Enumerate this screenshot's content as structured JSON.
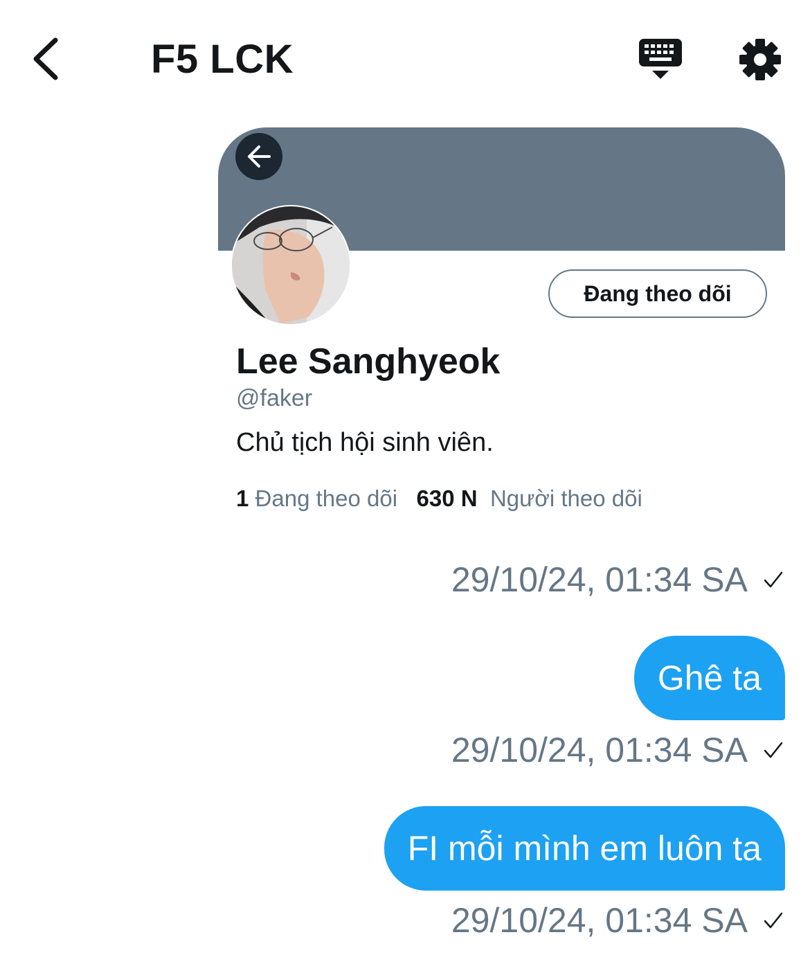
{
  "header": {
    "title": "F5 LCK",
    "back_icon": "chevron-left-icon",
    "keyboard_icon": "keyboard-icon",
    "settings_icon": "gear-icon"
  },
  "profile_card": {
    "banner_color": "#657786",
    "banner_back_icon": "arrow-left-icon",
    "follow_button_label": "Đang theo dõi",
    "name": "Lee Sanghyeok",
    "handle": "@faker",
    "bio": "Chủ tịch hội sinh viên.",
    "following_count": "1",
    "following_label": "Đang theo dõi",
    "followers_count": "630 N",
    "followers_label": "Người theo dõi"
  },
  "messages": [
    {
      "timestamp": "29/10/24, 01:34 SA"
    },
    {
      "text": "Ghê ta",
      "timestamp": "29/10/24, 01:34 SA"
    },
    {
      "text": "FI mỗi mình em luôn ta",
      "timestamp": "29/10/24, 01:34 SA"
    }
  ],
  "colors": {
    "accent": "#1da1f2",
    "secondary_text": "#657786",
    "primary_text": "#14171a"
  }
}
